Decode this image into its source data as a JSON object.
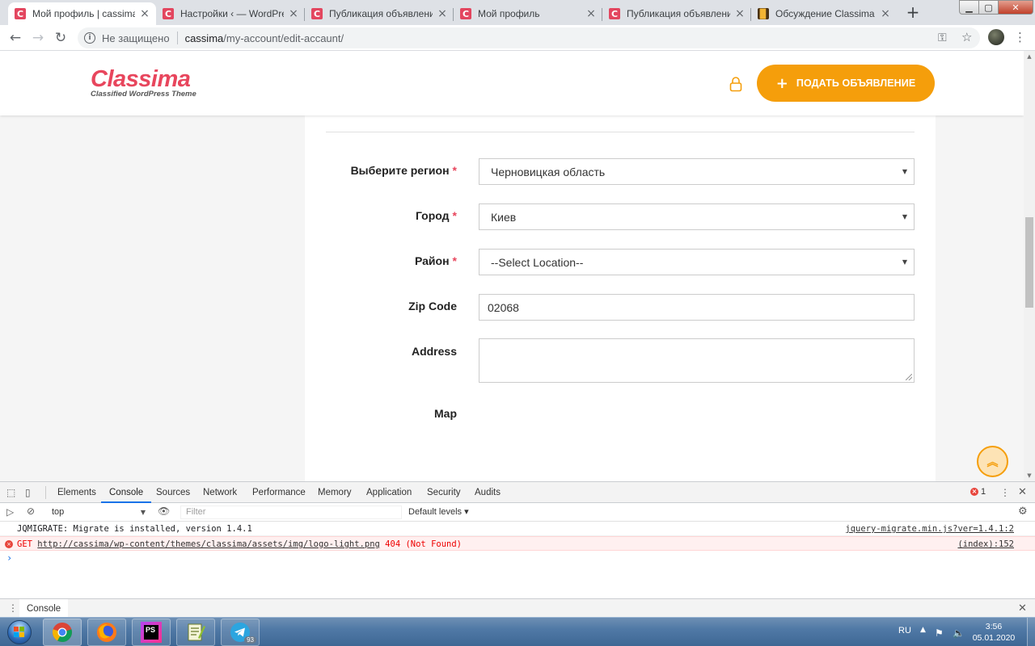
{
  "browser": {
    "tabs": [
      {
        "title": "Мой профиль | cassima",
        "favicon": "C",
        "active": true
      },
      {
        "title": "Настройки ‹ — WordPress",
        "favicon": "C",
        "active": false
      },
      {
        "title": "Публикация объявления",
        "favicon": "C",
        "active": false
      },
      {
        "title": "Мой профиль",
        "favicon": "C",
        "active": false
      },
      {
        "title": "Публикация объявления",
        "favicon": "C",
        "active": false
      },
      {
        "title": "Обсуждение Classima - До",
        "favicon": "▉",
        "active": false
      }
    ],
    "tab_close_glyph": "×",
    "new_tab_glyph": "+",
    "window_controls": {
      "minimize": "▁",
      "maximize": "▢",
      "close": "✕"
    },
    "security_label": "Не защищено",
    "url_host": "cassima",
    "url_path": "/my-account/edit-accaunt/"
  },
  "header": {
    "logo_text": "Classima",
    "logo_tagline": "Classified WordPress Theme",
    "post_ad_label": "ПОДАТЬ ОБЪЯВЛЕНИЕ",
    "post_ad_icon": "+"
  },
  "form": {
    "region": {
      "label": "Выберите регион",
      "required_mark": "*",
      "value": "Черновицкая область"
    },
    "city": {
      "label": "Город",
      "required_mark": "*",
      "value": "Киев"
    },
    "district": {
      "label": "Район",
      "required_mark": "*",
      "value": "--Select Location--"
    },
    "zip": {
      "label": "Zip Code",
      "value": "02068"
    },
    "address": {
      "label": "Address",
      "value": ""
    },
    "map": {
      "label": "Map"
    }
  },
  "scroll_top_glyph": "︽",
  "devtools": {
    "tabs": [
      "Elements",
      "Console",
      "Sources",
      "Network",
      "Performance",
      "Memory",
      "Application",
      "Security",
      "Audits"
    ],
    "active_tab": "Console",
    "error_count": "1",
    "context": "top",
    "filter_placeholder": "Filter",
    "levels_label": "Default levels ▾",
    "messages": [
      {
        "type": "log",
        "text": "JQMIGRATE: Migrate is installed, version 1.4.1",
        "source": "jquery-migrate.min.js?ver=1.4.1:2"
      },
      {
        "type": "error",
        "method": "GET",
        "url": "http://cassima/wp-content/themes/classima/assets/img/logo-light.png",
        "status": "404 (Not Found)",
        "source": "(index):152"
      }
    ],
    "prompt": "›",
    "drawer_tab": "Console"
  },
  "taskbar": {
    "apps": [
      "chrome",
      "firefox",
      "phpstorm",
      "notepad-plus-plus",
      "telegram"
    ],
    "telegram_badge": "93",
    "phpstorm_label": "PS",
    "language": "RU",
    "time": "3:56",
    "date": "05.01.2020"
  },
  "colors": {
    "brand": "#e8465d",
    "accent": "#f59e0b",
    "devtools_active": "#1a73e8",
    "error": "#e8453c"
  }
}
